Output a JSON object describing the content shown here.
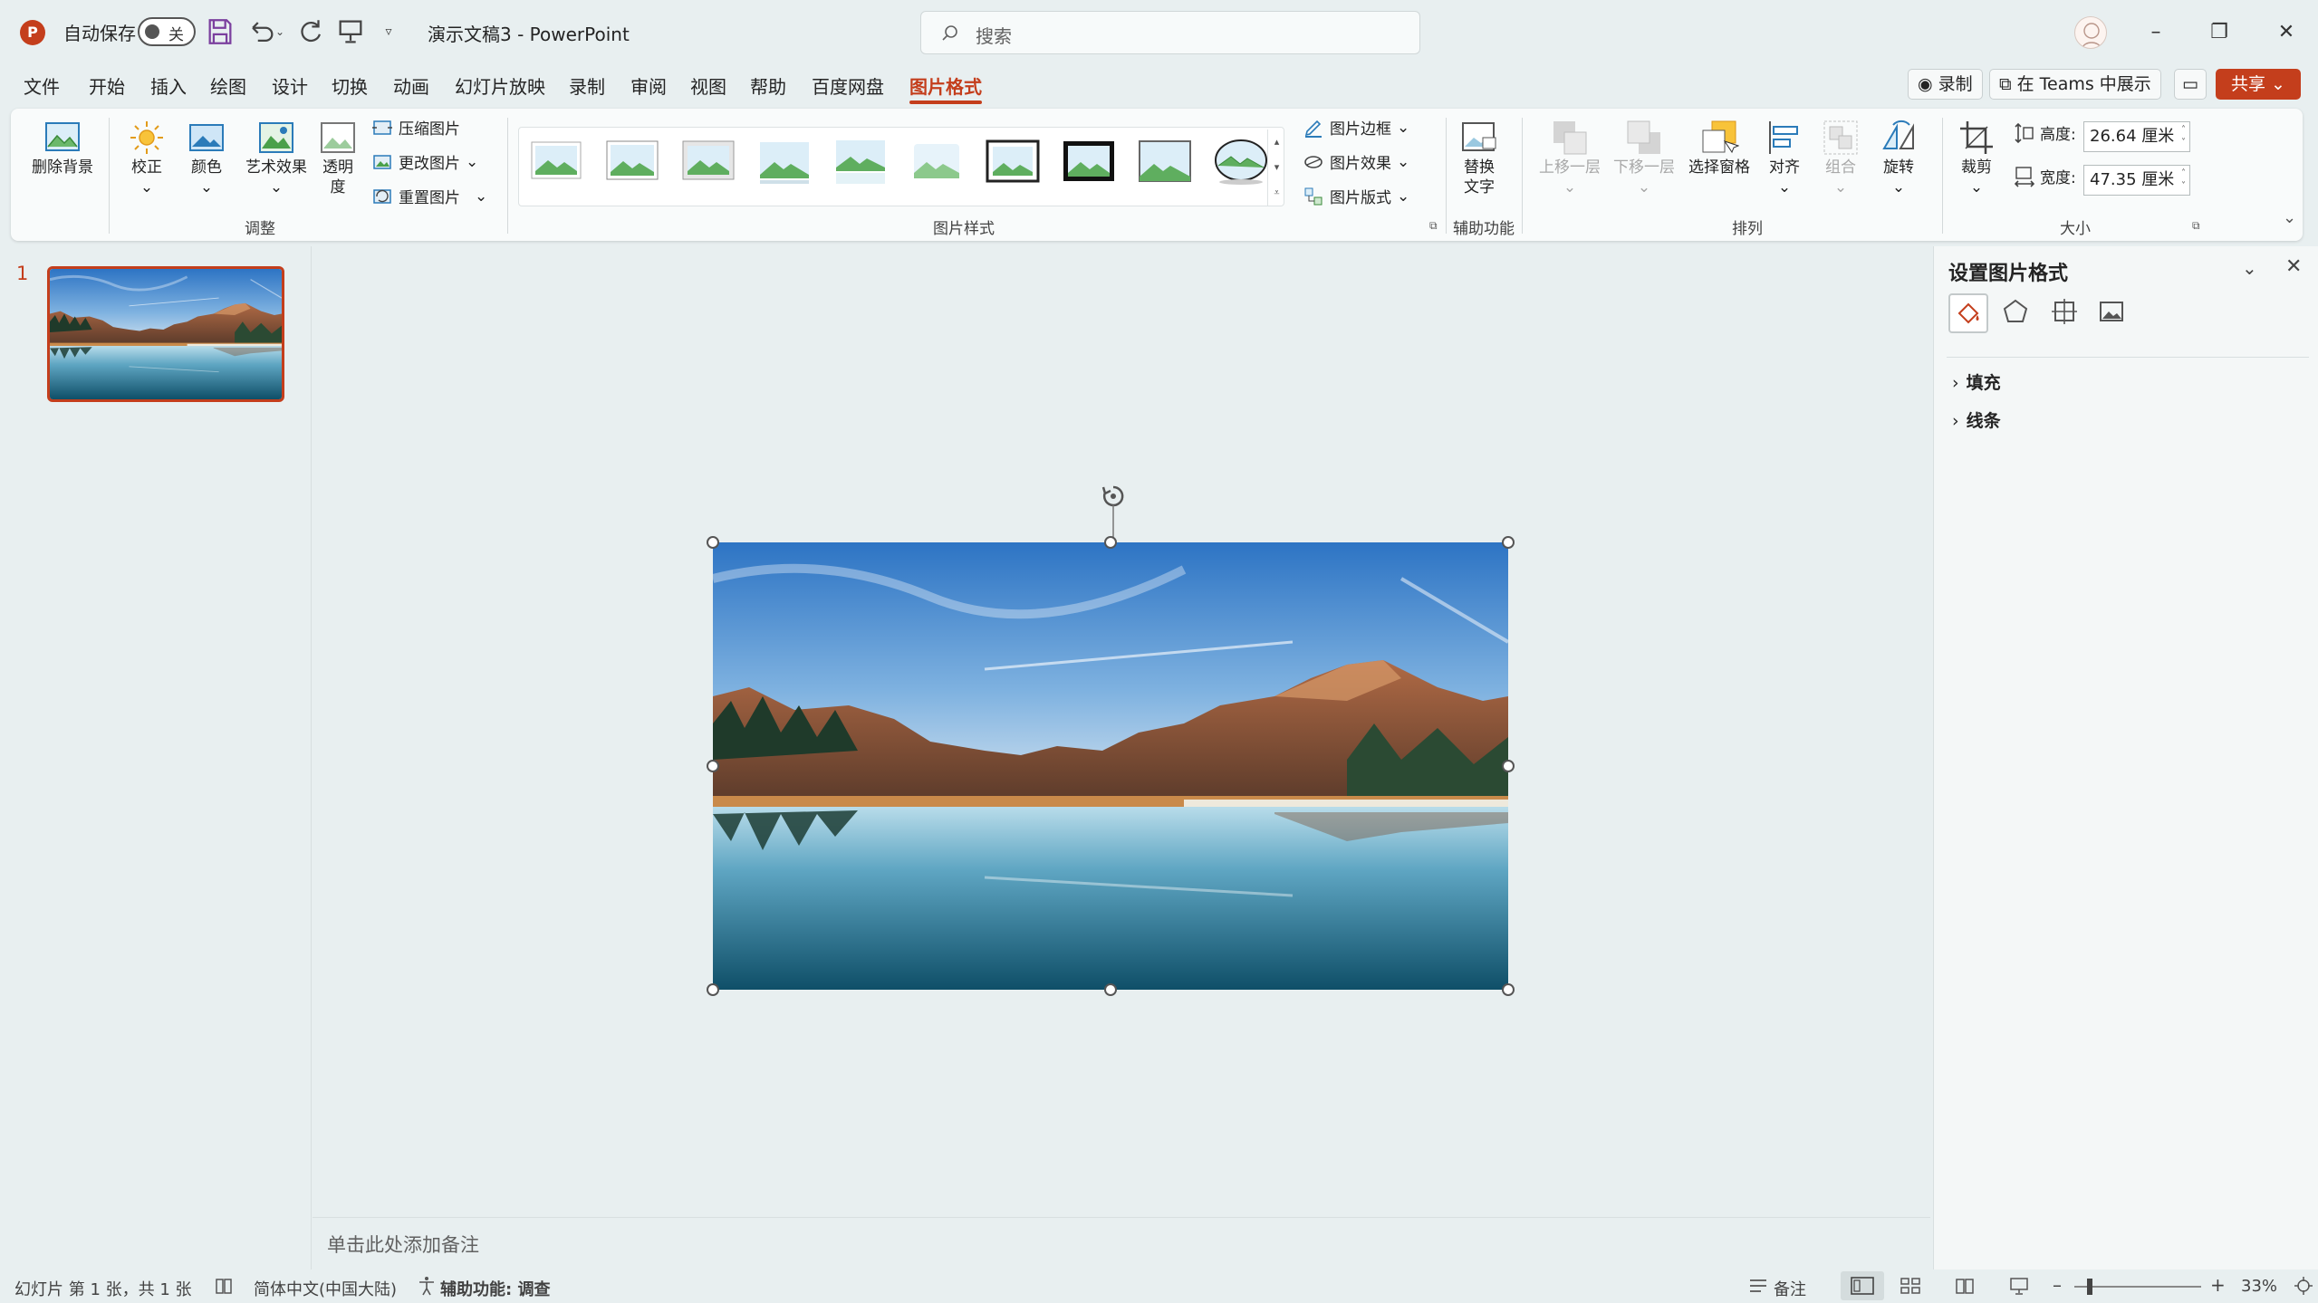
{
  "app": {
    "autosave_label": "自动保存",
    "autosave_state": "关",
    "document_title": "演示文稿3  -  PowerPoint",
    "search_placeholder": "搜索"
  },
  "menu_tabs": [
    "文件",
    "开始",
    "插入",
    "绘图",
    "设计",
    "切换",
    "动画",
    "幻灯片放映",
    "录制",
    "审阅",
    "视图",
    "帮助",
    "百度网盘",
    "图片格式"
  ],
  "header_buttons": {
    "record": "录制",
    "teams": "在 Teams 中展示",
    "share": "共享"
  },
  "ribbon": {
    "remove_bg": "删除背景",
    "corrections": "校正",
    "color": "颜色",
    "artistic": "艺术效果",
    "transparency_1": "透明",
    "transparency_2": "度",
    "compress": "压缩图片",
    "change_picture": "更改图片",
    "reset_picture": "重置图片",
    "group_adjust": "调整",
    "group_styles": "图片样式",
    "picture_border": "图片边框",
    "picture_effects": "图片效果",
    "picture_layout": "图片版式",
    "alt_text_1": "替换",
    "alt_text_2": "文字",
    "group_accessibility": "辅助功能",
    "bring_forward": "上移一层",
    "send_backward": "下移一层",
    "selection_pane": "选择窗格",
    "align": "对齐",
    "group": "组合",
    "rotate": "旋转",
    "group_arrange": "排列",
    "crop": "裁剪",
    "height_label": "高度:",
    "height_value": "26.64 厘米",
    "width_label": "宽度:",
    "width_value": "47.35 厘米",
    "group_size": "大小"
  },
  "slides_panel": {
    "slide_number": "1"
  },
  "notes_placeholder": "单击此处添加备注",
  "format_pane": {
    "title": "设置图片格式",
    "sections": [
      "填充",
      "线条"
    ]
  },
  "status_bar": {
    "slide_info": "幻灯片 第 1 张，共 1 张",
    "language": "简体中文(中国大陆)",
    "accessibility": "辅助功能: 调查",
    "notes": "备注",
    "zoom": "33%"
  },
  "colors": {
    "accent": "#c43e1c",
    "background": "#e8eff0",
    "ribbon": "#f9fbfb"
  }
}
